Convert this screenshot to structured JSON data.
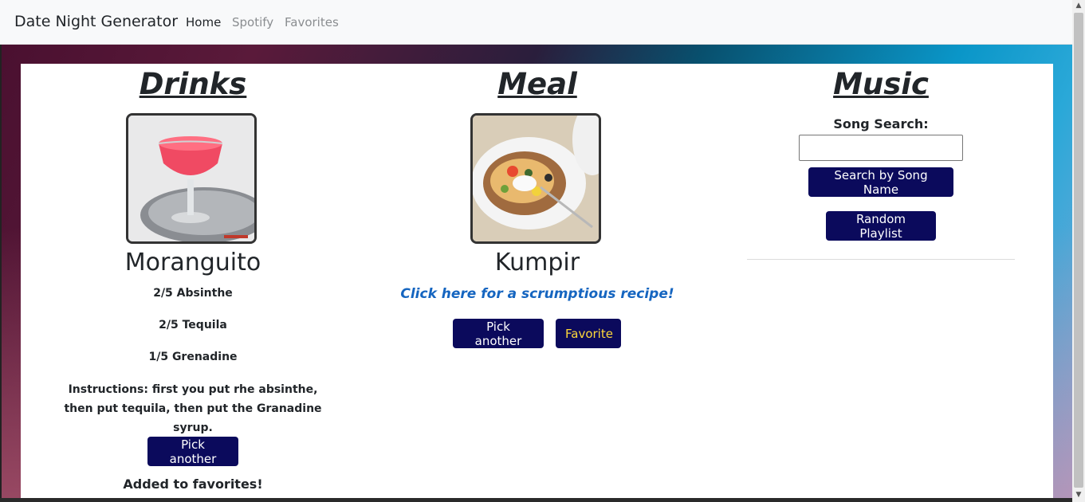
{
  "navbar": {
    "brand": "Date Night Generator",
    "links": [
      {
        "label": "Home",
        "active": true
      },
      {
        "label": "Spotify",
        "active": false
      },
      {
        "label": "Favorites",
        "active": false
      }
    ]
  },
  "drinks": {
    "title": "Drinks",
    "name": "Moranguito",
    "image_icon": "cocktail-photo",
    "ingredients": [
      "2/5 Absinthe",
      "2/5 Tequila",
      "1/5 Grenadine"
    ],
    "instructions": "Instructions: first you put rhe absinthe, then put tequila, then put the Granadine syrup.",
    "pick_another": "Pick another",
    "status": "Added to favorites!"
  },
  "meal": {
    "title": "Meal",
    "name": "Kumpir",
    "image_icon": "baked-potato-photo",
    "recipe_link": "Click here for a scrumptious recipe!",
    "pick_another": "Pick another",
    "favorite": "Favorite"
  },
  "music": {
    "title": "Music",
    "search_label": "Song Search:",
    "search_value": "",
    "search_button": "Search by Song Name",
    "random_button": "Random Playlist"
  },
  "colors": {
    "button_bg": "#0b0a5c",
    "favorite_text": "#ffd83a",
    "link": "#1565c0"
  }
}
